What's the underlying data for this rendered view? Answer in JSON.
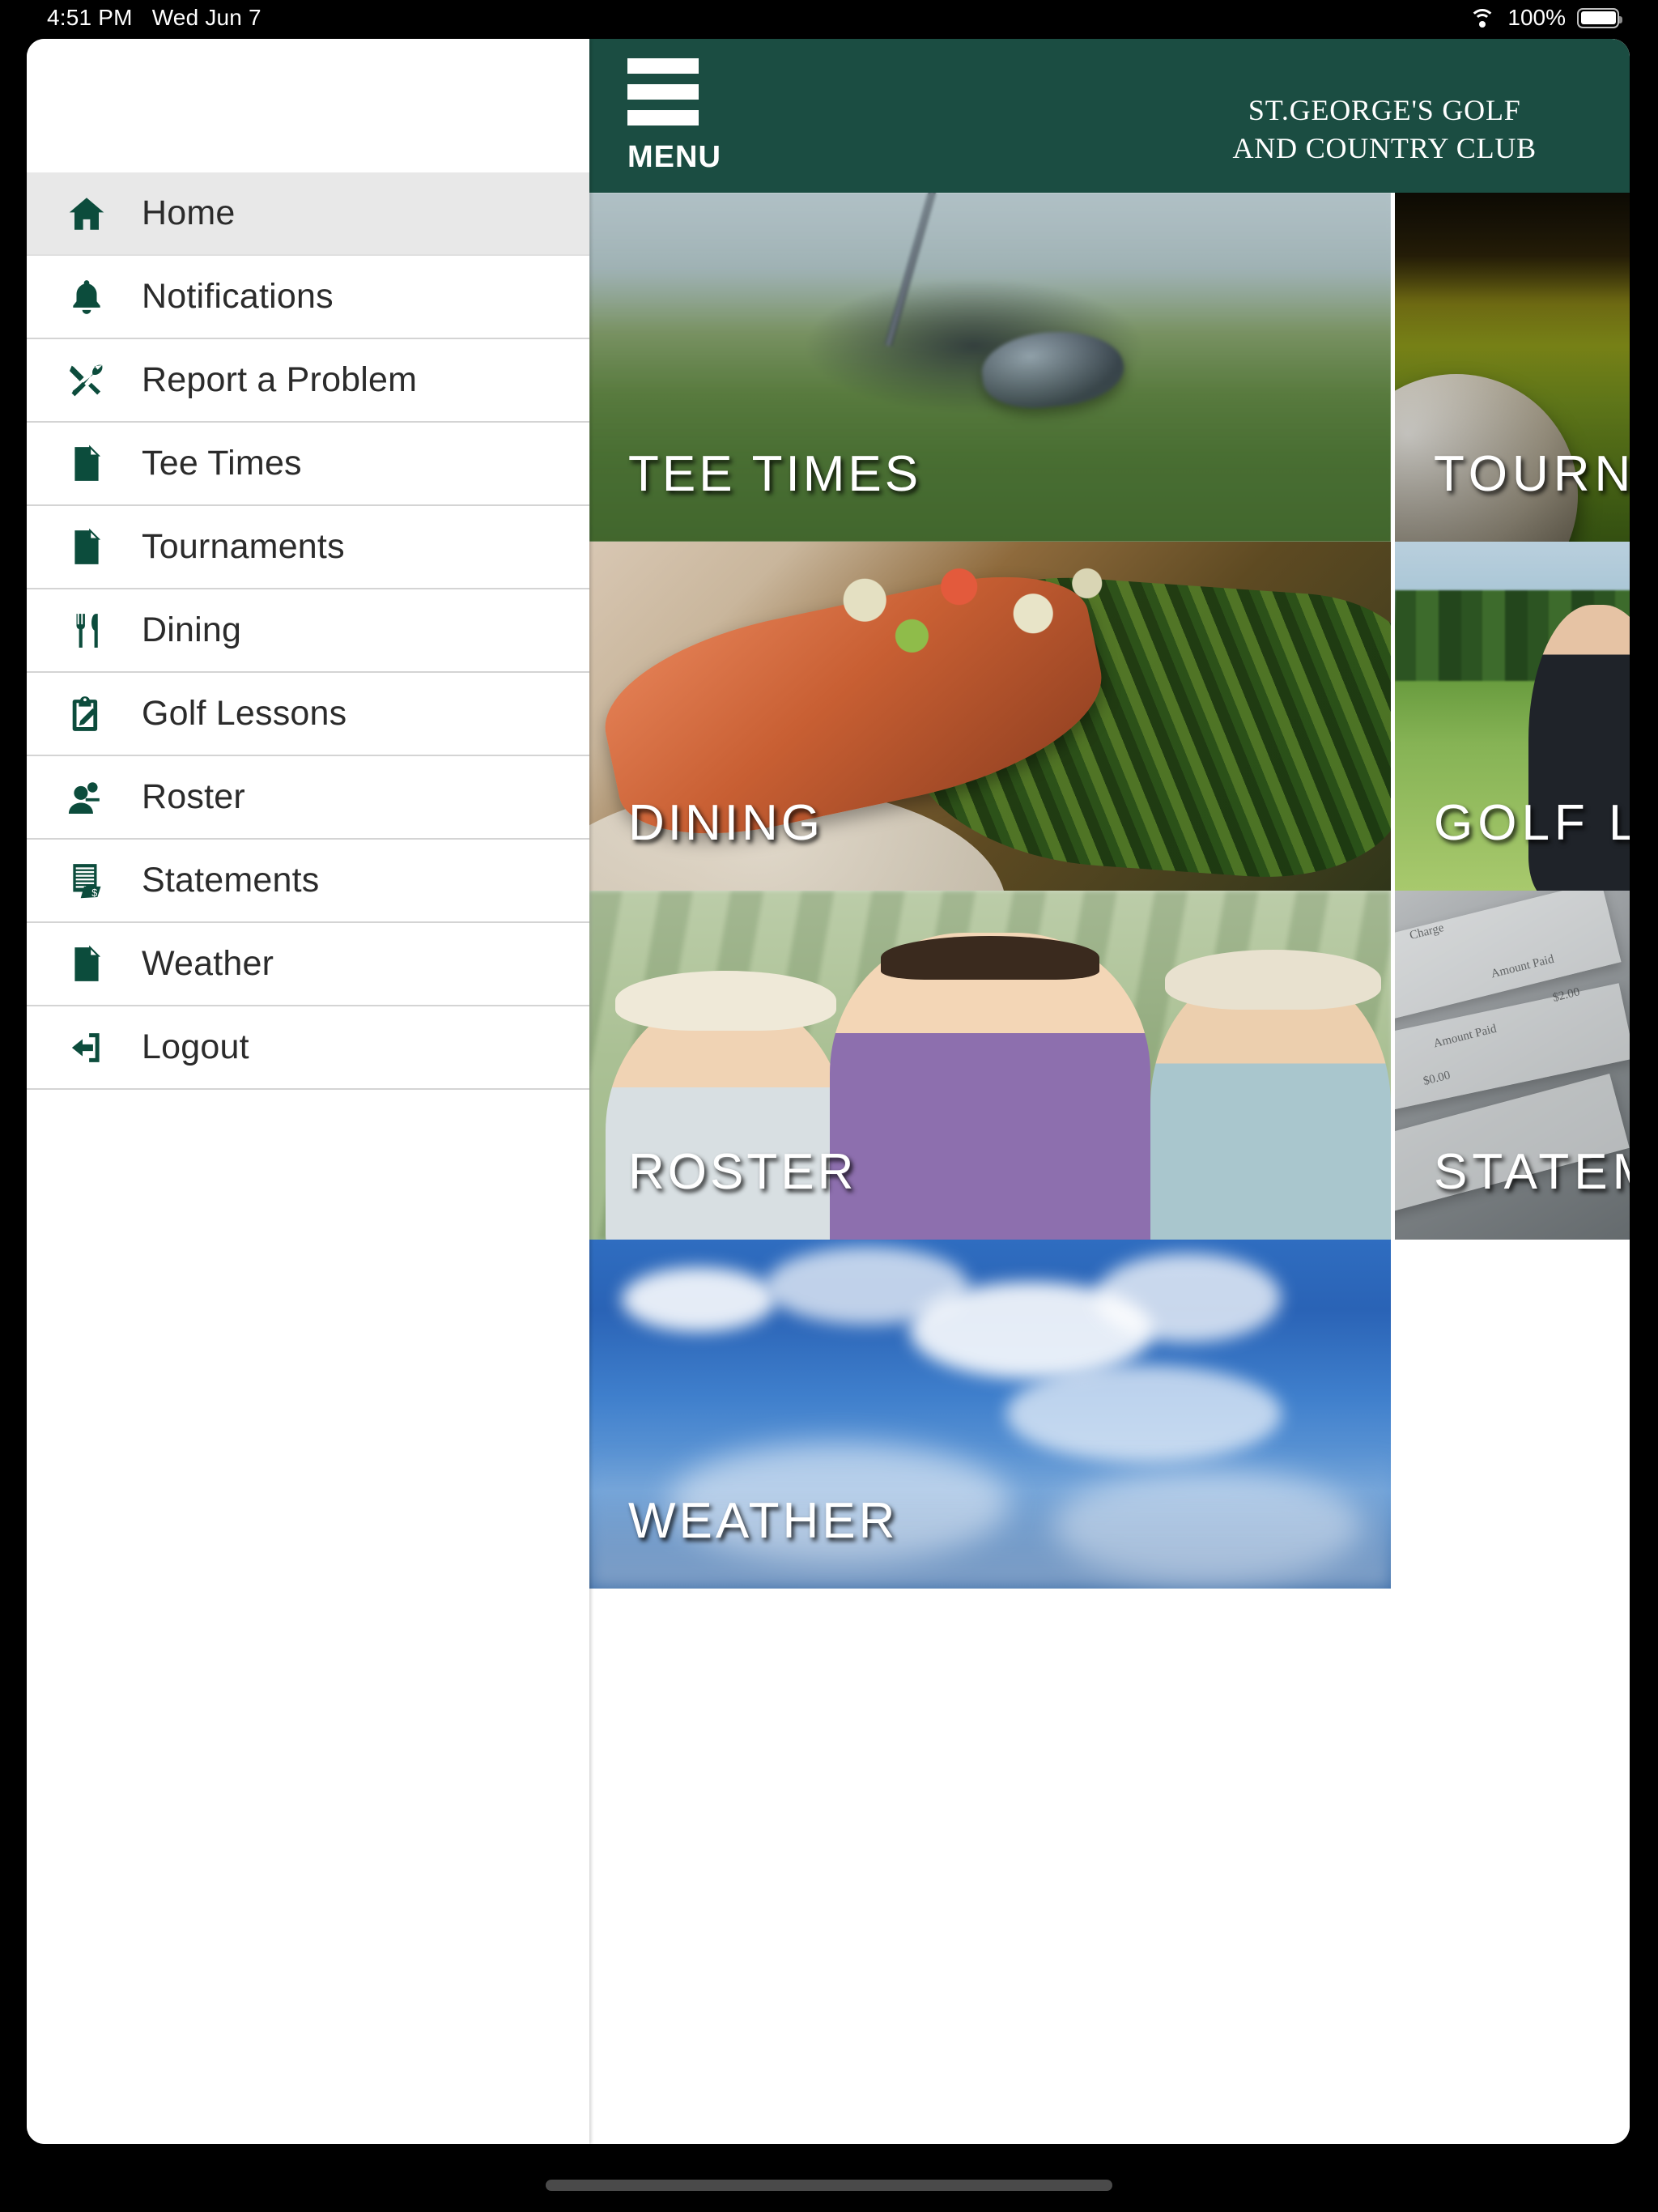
{
  "status_bar": {
    "time": "4:51 PM",
    "date": "Wed Jun 7",
    "battery_percent": "100%",
    "wifi_icon": "wifi-icon",
    "battery_icon": "battery-icon"
  },
  "sidebar": {
    "items": [
      {
        "label": "Home",
        "icon": "home-icon",
        "active": true
      },
      {
        "label": "Notifications",
        "icon": "bell-icon",
        "active": false
      },
      {
        "label": "Report a Problem",
        "icon": "tools-icon",
        "active": false
      },
      {
        "label": "Tee Times",
        "icon": "document-icon",
        "active": false
      },
      {
        "label": "Tournaments",
        "icon": "document-icon",
        "active": false
      },
      {
        "label": "Dining",
        "icon": "cutlery-icon",
        "active": false
      },
      {
        "label": "Golf Lessons",
        "icon": "clipboard-pencil-icon",
        "active": false
      },
      {
        "label": "Roster",
        "icon": "people-icon",
        "active": false
      },
      {
        "label": "Statements",
        "icon": "invoice-icon",
        "active": false
      },
      {
        "label": "Weather",
        "icon": "document-icon",
        "active": false
      },
      {
        "label": "Logout",
        "icon": "logout-icon",
        "active": false
      }
    ]
  },
  "header": {
    "menu_label": "MENU",
    "menu_icon": "hamburger-icon",
    "club_name_line1": "ST.GEORGE'S GOLF",
    "club_name_line2": "AND COUNTRY CLUB",
    "background_color": "#1b4d42"
  },
  "tiles": [
    {
      "label": "TEE TIMES",
      "image": "golf-driver-on-grass"
    },
    {
      "label": "TOURNAMENTS",
      "image": "golf-ball-on-fairway"
    },
    {
      "label": "DINING",
      "image": "salmon-dish-plated"
    },
    {
      "label": "GOLF LESSONS",
      "image": "golfer-on-fairway"
    },
    {
      "label": "ROSTER",
      "image": "three-smiling-golfers"
    },
    {
      "label": "STATEMENTS",
      "image": "billing-statement-papers"
    },
    {
      "label": "WEATHER",
      "image": "blue-sky-with-clouds"
    }
  ],
  "statement_art_text": {
    "l1": "Charge",
    "l2": "Amount Paid",
    "l3": "$2.00",
    "l4": "Amount Paid",
    "l5": "$0.00"
  },
  "colors": {
    "brand_green": "#1b4d42",
    "icon_green": "#0c4c3c",
    "active_row": "#e8e8e8",
    "divider": "#d4d4d4"
  }
}
